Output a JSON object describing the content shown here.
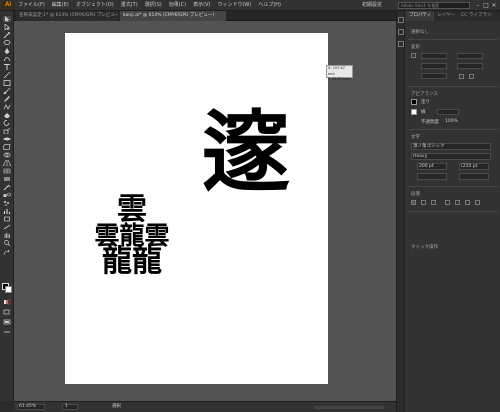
{
  "app": {
    "logo": "Ai",
    "accent": "#ff9a00"
  },
  "menubar": {
    "items": [
      "ファイル(F)",
      "編集(E)",
      "オブジェクト(O)",
      "書式(T)",
      "選択(S)",
      "効果(C)",
      "表示(V)",
      "ウィンドウ(W)",
      "ヘルプ(H)"
    ],
    "workspace": "初期設定",
    "search_placeholder": "Adobe Stock を検索",
    "window_buttons": [
      "–",
      "□",
      "×"
    ]
  },
  "tabs": [
    {
      "label": "名称未設定-1* @ 614% (CMYK/GPU プレビュー)"
    },
    {
      "label": "kanji.ai* @ 614% (CMYK/GPU プレビュー)"
    }
  ],
  "canvas": {
    "kanji_big": "𨗉",
    "kanji_stack": {
      "top": "雲",
      "middle": "雲龍雲",
      "bottom": "龍龍"
    },
    "tooltip": {
      "line1": "X: 197.87 mm",
      "line2": "Y: 28.87 mm"
    }
  },
  "status": {
    "zoom": "61.45%",
    "page": "1",
    "text": "選択"
  },
  "right_panel": {
    "tabs": [
      "プロパティ",
      "レイヤー",
      "CC ライブラリ"
    ],
    "selection_label": "選択なし",
    "transform_title": "変形",
    "appearance_title": "アピアランス",
    "fill_label": "塗り",
    "stroke_label": "線",
    "opacity_label": "不透明度",
    "opacity_value": "100%",
    "character_title": "文字",
    "font_family": "源ノ角ゴシック",
    "font_style": "Heavy",
    "font_size": "200 pt",
    "leading": "(250 pt",
    "paragraph_title": "段落",
    "quick_actions_title": "クイック操作"
  },
  "colors": {
    "canvas": "#535353",
    "panel": "#323232",
    "artboard": "#ffffff"
  }
}
